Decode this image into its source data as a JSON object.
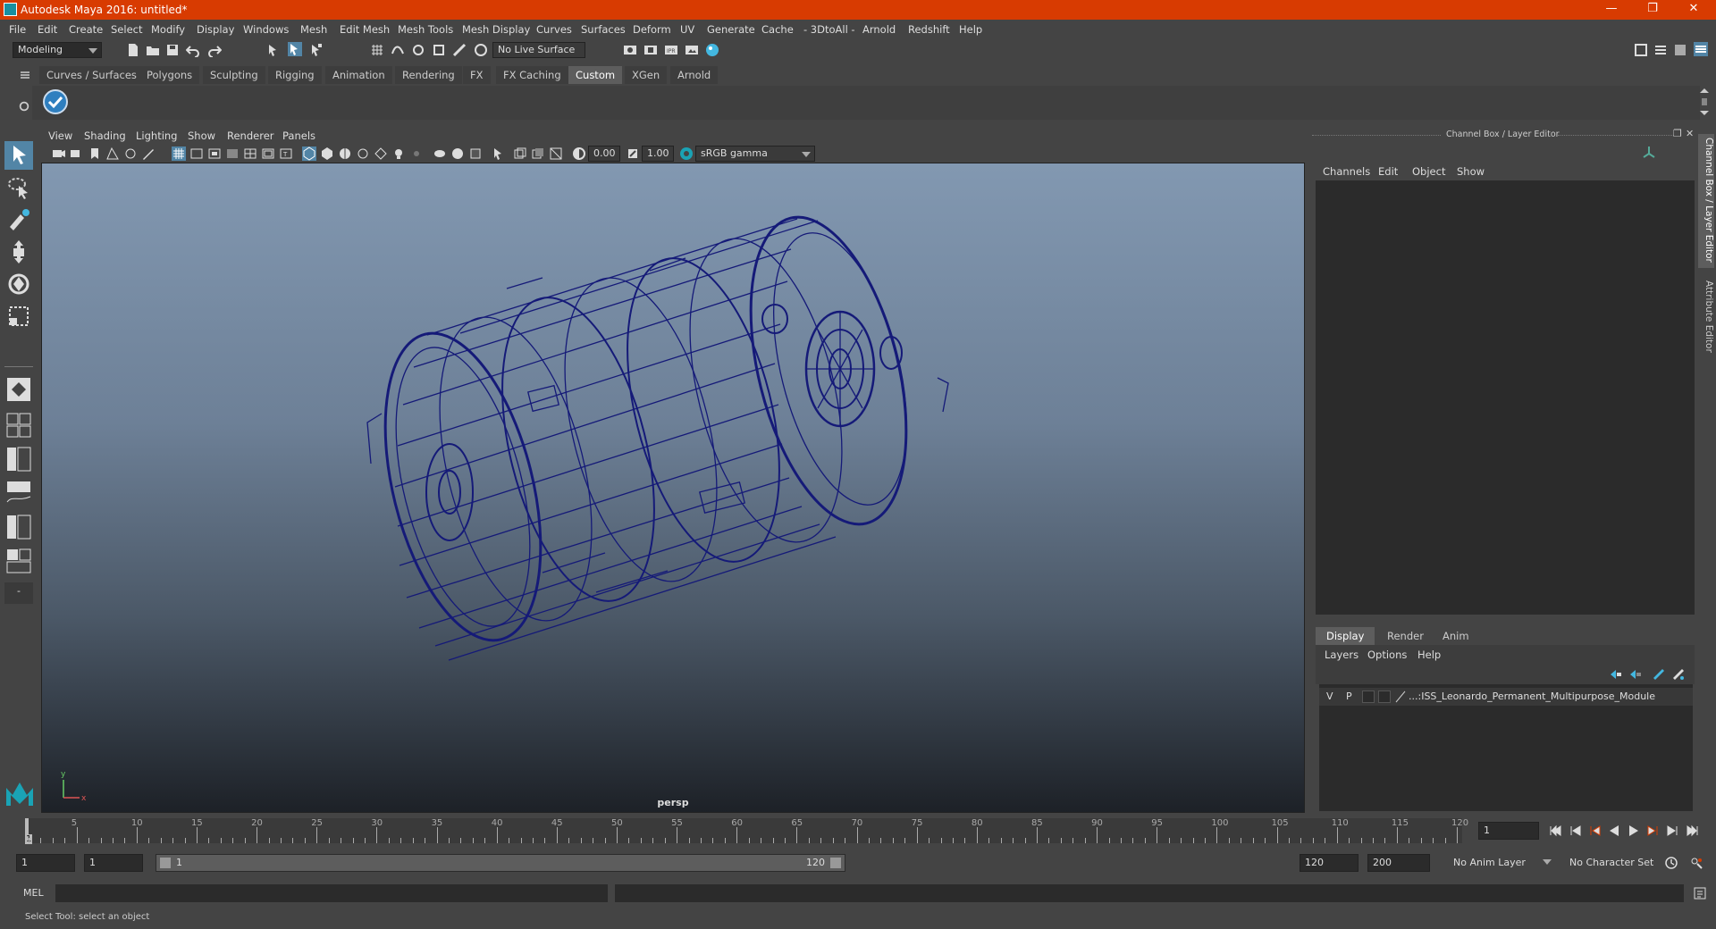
{
  "window": {
    "title": "Autodesk Maya 2016: untitled*"
  },
  "menubar": [
    "File",
    "Edit",
    "Create",
    "Select",
    "Modify",
    "Display",
    "Windows",
    "Mesh",
    "Edit Mesh",
    "Mesh Tools",
    "Mesh Display",
    "Curves",
    "Surfaces",
    "Deform",
    "UV",
    "Generate",
    "Cache",
    "- 3DtoAll -",
    "Arnold",
    "Redshift",
    "Help"
  ],
  "statusline": {
    "mode": "Modeling",
    "live_surface": "No Live Surface"
  },
  "shelf_tabs": [
    "Curves / Surfaces",
    "Polygons",
    "Sculpting",
    "Rigging",
    "Animation",
    "Rendering",
    "FX",
    "FX Caching",
    "Custom",
    "XGen",
    "Arnold"
  ],
  "shelf_active_tab": "Custom",
  "viewport": {
    "menu": [
      "View",
      "Shading",
      "Lighting",
      "Show",
      "Renderer",
      "Panels"
    ],
    "exposure": "0.00",
    "gamma": "1.00",
    "color_space": "sRGB gamma",
    "camera_label": "persp",
    "axis_y": "y",
    "axis_x": "x"
  },
  "channel_box": {
    "title": "Channel Box / Layer Editor",
    "menu": [
      "Channels",
      "Edit",
      "Object",
      "Show"
    ]
  },
  "layer_editor": {
    "tabs": [
      "Display",
      "Render",
      "Anim"
    ],
    "active_tab": "Display",
    "menu": [
      "Layers",
      "Options",
      "Help"
    ],
    "layers": [
      {
        "v": "V",
        "p": "P",
        "name": "...:ISS_Leonardo_Permanent_Multipurpose_Module"
      }
    ]
  },
  "side_tabs": [
    "Channel Box / Layer Editor",
    "Attribute Editor"
  ],
  "timeslider": {
    "ticks": [
      "5",
      "10",
      "15",
      "20",
      "25",
      "30",
      "35",
      "40",
      "45",
      "50",
      "55",
      "60",
      "65",
      "70",
      "75",
      "80",
      "85",
      "90",
      "95",
      "100",
      "105",
      "110",
      "115",
      "120"
    ],
    "start_label": "1",
    "current_frame": "1"
  },
  "rangeslider": {
    "start": "1",
    "playback_start": "1",
    "range_min_label": "1",
    "range_max_label": "120",
    "playback_end": "120",
    "end": "200",
    "anim_layer": "No Anim Layer",
    "character_set": "No Character Set"
  },
  "cmdline": {
    "label": "MEL"
  },
  "helpline": {
    "text": "Select Tool: select an object"
  }
}
